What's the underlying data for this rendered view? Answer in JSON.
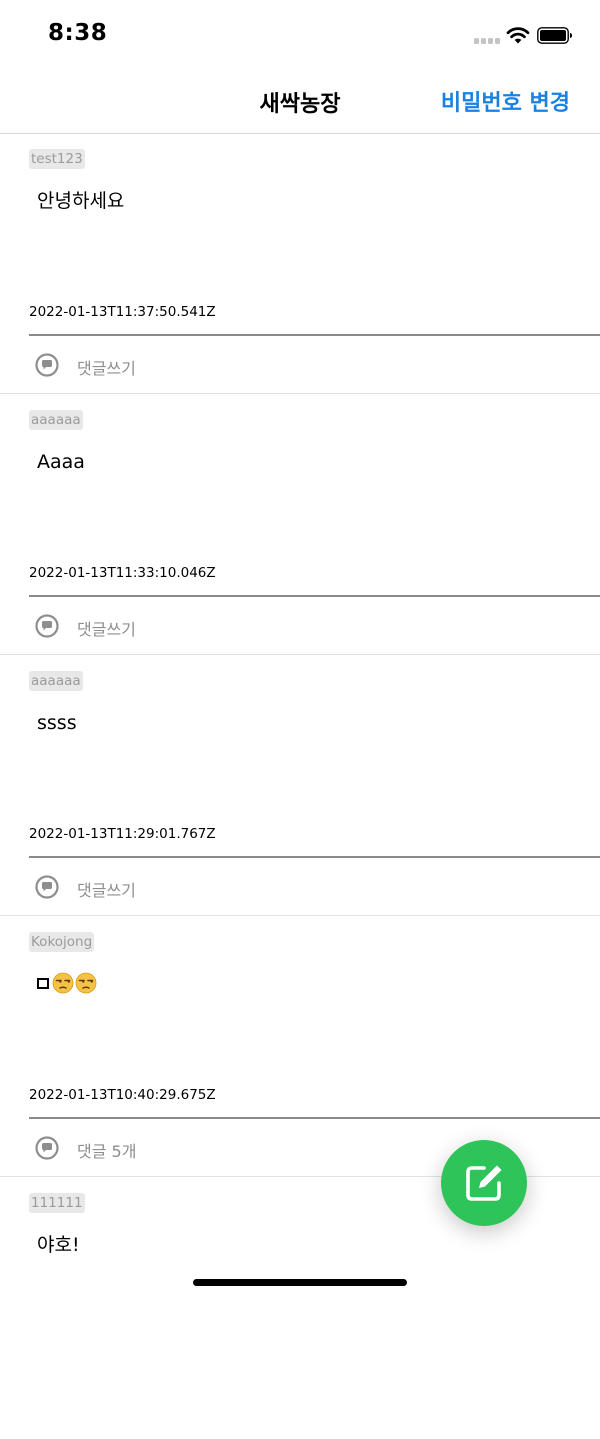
{
  "status_bar": {
    "time": "8:38"
  },
  "nav": {
    "title": "새싹농장",
    "action": "비밀번호 변경"
  },
  "colors": {
    "accent": "#1a82e2",
    "fab": "#2ec45a"
  },
  "posts": [
    {
      "author": "test123",
      "text": "안녕하세요",
      "timestamp": "2022-01-13T11:37:50.541Z",
      "comment_label": "댓글쓰기"
    },
    {
      "author": "aaaaaa",
      "text": "Aaaa",
      "timestamp": "2022-01-13T11:33:10.046Z",
      "comment_label": "댓글쓰기"
    },
    {
      "author": "aaaaaa",
      "text": "ssss",
      "timestamp": "2022-01-13T11:29:01.767Z",
      "comment_label": "댓글쓰기"
    },
    {
      "author": "Kokojong",
      "text": "ㅁ😒😒",
      "timestamp": "2022-01-13T10:40:29.675Z",
      "comment_label": "댓글 5개"
    },
    {
      "author": "111111",
      "text": "야호!"
    }
  ],
  "icons": {
    "comment": "speech-bubble-icon",
    "fab": "compose-icon"
  }
}
